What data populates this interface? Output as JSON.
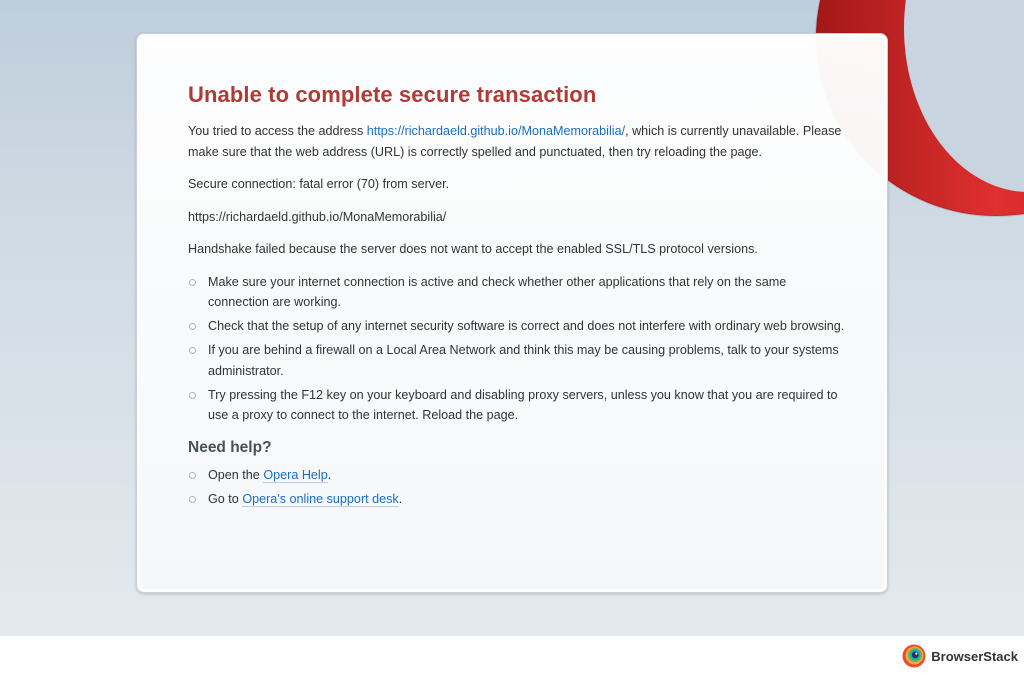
{
  "page": {
    "title": "Unable to complete secure transaction",
    "intro": {
      "before_link": "You tried to access the address ",
      "url": "https://richardaeld.github.io/MonaMemorabilia/",
      "after_link": ", which is currently unavailable. Please make sure that the web address (URL) is correctly spelled and punctuated, then try reloading the page."
    },
    "error_detail": "Secure connection: fatal error (70) from server.",
    "error_url": "https://richardaeld.github.io/MonaMemorabilia/",
    "handshake": "Handshake failed because the server does not want to accept the enabled SSL/TLS protocol versions.",
    "tips": [
      "Make sure your internet connection is active and check whether other applications that rely on the same connection are working.",
      "Check that the setup of any internet security software is correct and does not interfere with ordinary web browsing.",
      "If you are behind a firewall on a Local Area Network and think this may be causing problems, talk to your systems administrator.",
      "Try pressing the F12 key on your keyboard and disabling proxy servers, unless you know that you are required to use a proxy to connect to the internet. Reload the page."
    ],
    "help": {
      "title": "Need help?",
      "items": [
        {
          "before": "Open the ",
          "link": "Opera Help",
          "after": "."
        },
        {
          "before": "Go to ",
          "link": "Opera's online support desk",
          "after": "."
        }
      ]
    }
  },
  "footer": {
    "brand": "BrowserStack",
    "icon": "browserstack-logo-icon"
  },
  "decor": {
    "opera_logo": "opera-logo-icon"
  },
  "colors": {
    "title": "#b03a36",
    "link": "#1a6ec4",
    "opera_red": "#d42a2a"
  }
}
